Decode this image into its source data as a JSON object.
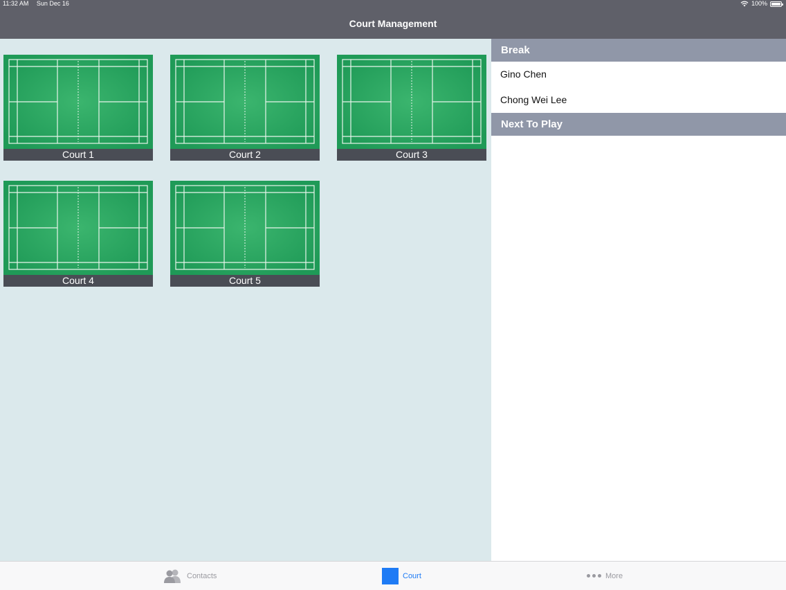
{
  "status_bar": {
    "time": "11:32 AM",
    "date": "Sun Dec 16",
    "battery": "100%"
  },
  "nav": {
    "title": "Court Management"
  },
  "courts": [
    {
      "label": "Court 1"
    },
    {
      "label": "Court 2"
    },
    {
      "label": "Court 3"
    },
    {
      "label": "Court 4"
    },
    {
      "label": "Court 5"
    }
  ],
  "side_panel": {
    "break_header": "Break",
    "break_players": [
      "Gino Chen",
      "Chong Wei Lee"
    ],
    "next_header": "Next To Play",
    "next_players": []
  },
  "tabs": [
    {
      "label": "Contacts",
      "icon": "contacts-icon",
      "selected": false
    },
    {
      "label": "Court",
      "icon": "court-icon",
      "selected": true
    },
    {
      "label": "More",
      "icon": "more-icon",
      "selected": false
    }
  ],
  "colors": {
    "bar": "#5f6069",
    "accent": "#1e7bf5",
    "court_green": "#1f9a57",
    "section_header": "#9097a8",
    "main_bg": "#dbe9ec"
  }
}
